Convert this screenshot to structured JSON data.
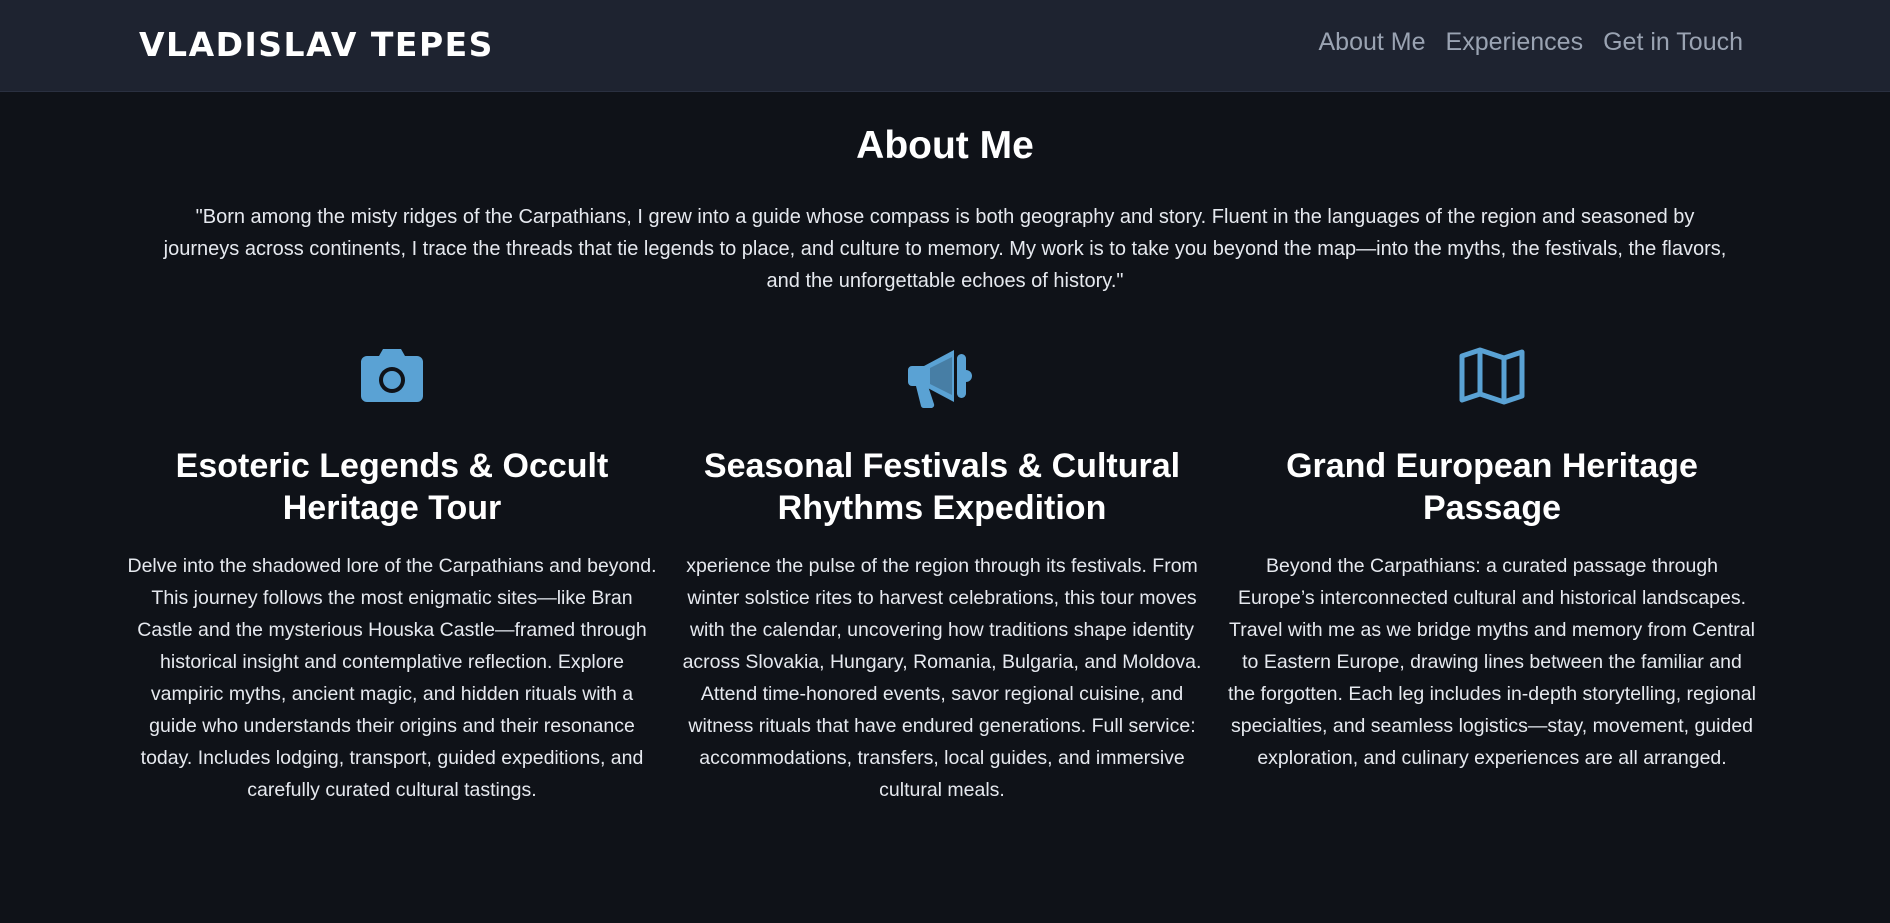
{
  "header": {
    "brand": "VLADISLAV TEPES",
    "nav": [
      "About Me",
      "Experiences",
      "Get in Touch"
    ]
  },
  "about": {
    "title": "About Me",
    "quote": "\"Born among the misty ridges of the Carpathians, I grew into a guide whose compass is both geography and story. Fluent in the languages of the region and seasoned by journeys across continents, I trace the threads that tie legends to place, and culture to memory. My work is to take you beyond the map—into the myths, the festivals, the flavors, and the unforgettable echoes of history.\""
  },
  "tours": [
    {
      "icon": "camera-icon",
      "title": "Esoteric Legends & Occult Heritage Tour",
      "description": "Delve into the shadowed lore of the Carpathians and beyond. This journey follows the most enigmatic sites—like Bran Castle and the mysterious Houska Castle—framed through historical insight and contemplative reflection. Explore vampiric myths, ancient magic, and hidden rituals with a guide who understands their origins and their resonance today. Includes lodging, transport, guided expeditions, and carefully curated cultural tastings."
    },
    {
      "icon": "megaphone-icon",
      "title": "Seasonal Festivals & Cultural Rhythms Expedition",
      "description": "xperience the pulse of the region through its festivals. From winter solstice rites to harvest celebrations, this tour moves with the calendar, uncovering how traditions shape identity across Slovakia, Hungary, Romania, Bulgaria, and Moldova. Attend time-honored events, savor regional cuisine, and witness rituals that have endured generations. Full service: accommodations, transfers, local guides, and immersive cultural meals."
    },
    {
      "icon": "map-icon",
      "title": "Grand European Heritage Passage",
      "description": "Beyond the Carpathians: a curated passage through Europe’s interconnected cultural and historical landscapes. Travel with me as we bridge myths and memory from Central to Eastern Europe, drawing lines between the familiar and the forgotten. Each leg includes in-depth storytelling, regional specialties, and seamless logistics—stay, movement, guided exploration, and culinary experiences are all arranged."
    }
  ],
  "colors": {
    "background": "#0f1218",
    "navbar": "#1e2330",
    "accent_icon": "#5aa2d4",
    "nav_link": "#9aa3b2"
  }
}
